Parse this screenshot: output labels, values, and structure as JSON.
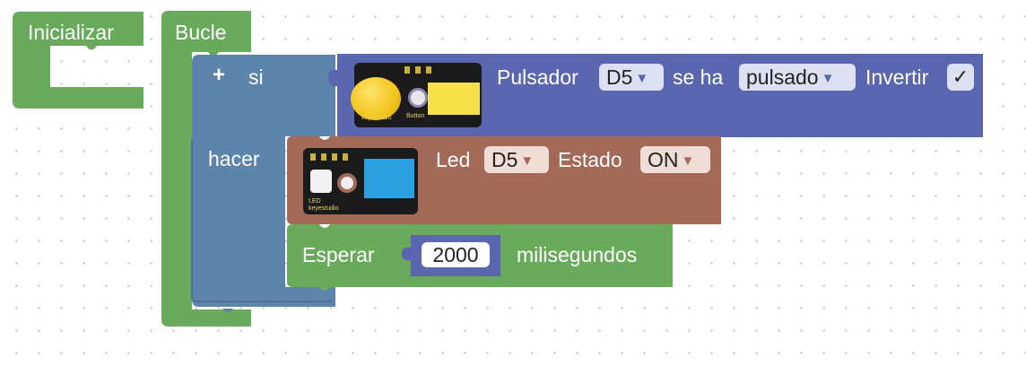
{
  "blocks": {
    "init": {
      "label": "Inicializar"
    },
    "loop": {
      "label": "Bucle"
    },
    "if": {
      "plus_symbol": "+",
      "if_label": "si",
      "do_label": "hacer"
    },
    "button": {
      "label": "Pulsador",
      "pin": "D5",
      "mid_label": "se ha",
      "state": "pulsado",
      "invert_label": "Invertir",
      "invert_checked": "✓",
      "module_brand": "keyestudio",
      "module_name": "Button"
    },
    "led": {
      "label": "Led",
      "pin": "D5",
      "state_label": "Estado",
      "state": "ON",
      "module_brand": "keyestudio",
      "module_name": "LED"
    },
    "wait": {
      "label": "Esperar",
      "value": "2000",
      "unit": "milisegundos"
    },
    "dropdown_arrow": "▼"
  },
  "colors": {
    "green_block": "#6aaa5d",
    "control_block": "#5d85ac",
    "button_block": "#5b66b1",
    "led_block": "#a36a58",
    "number_block": "#5b66b1"
  }
}
